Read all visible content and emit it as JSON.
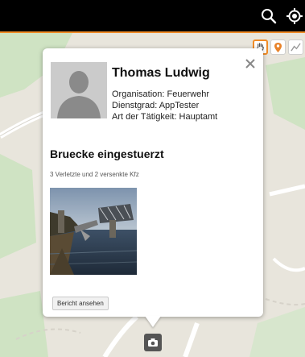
{
  "topbar": {
    "icons": [
      "search-icon",
      "locate-icon"
    ]
  },
  "map_tools": [
    "hand-tool-icon",
    "pin-tool-icon",
    "line-tool-icon"
  ],
  "popup": {
    "name": "Thomas Ludwig",
    "organisation": "Organisation: Feuerwehr",
    "rank": "Dienstgrad: AppTester",
    "activity": "Art der Tätigkeit: Hauptamt",
    "report_title": "Bruecke eingestuerzt",
    "report_summary": "3 Verletzte und 2 versenkte Kfz",
    "view_report_label": "Bericht ansehen"
  },
  "colors": {
    "accent": "#f08c28",
    "topbar": "#000000",
    "map": "#e8e5dc",
    "map_green": "#cfe3c3"
  }
}
